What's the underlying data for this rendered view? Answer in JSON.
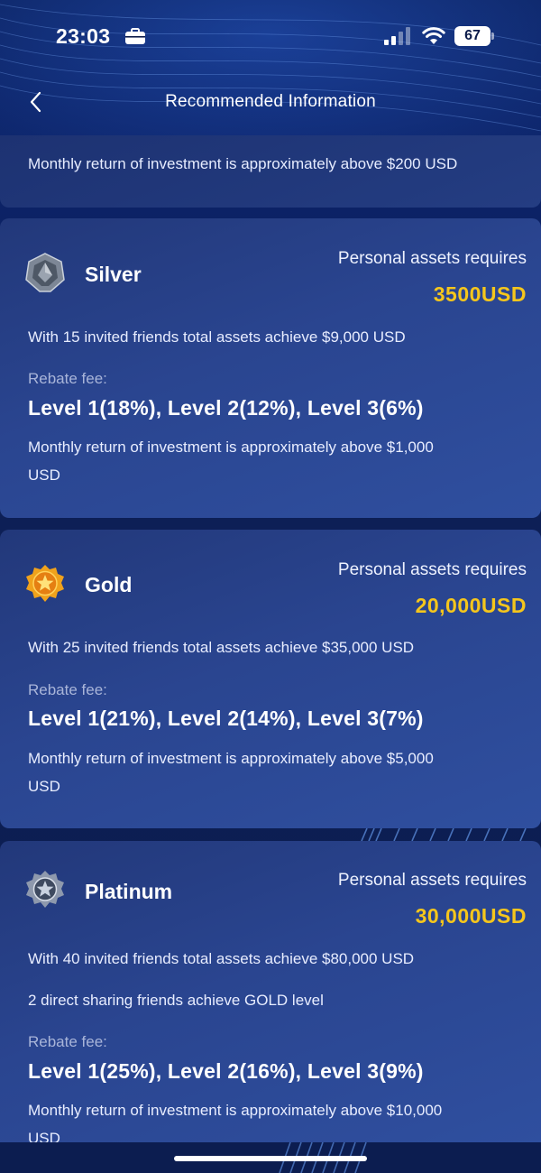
{
  "status_bar": {
    "time": "23:03",
    "battery": "67"
  },
  "nav": {
    "title": "Recommended Information"
  },
  "top_card": {
    "monthly_return": "Monthly return of investment is approximately above $200 USD"
  },
  "tiers": [
    {
      "name": "Silver",
      "icon": "silver-badge-icon",
      "requirement_label": "Personal assets requires",
      "requirement_value": "3500USD",
      "invited_friends": "With 15 invited friends total assets achieve $9,000 USD",
      "rebate_label": "Rebate fee:",
      "rebate_value": "Level 1(18%), Level 2(12%), Level 3(6%)",
      "monthly_return_1": "Monthly return of investment is approximately above $1,000",
      "monthly_return_2": "USD"
    },
    {
      "name": "Gold",
      "icon": "gold-badge-icon",
      "requirement_label": "Personal assets requires",
      "requirement_value": "20,000USD",
      "invited_friends": "With 25 invited friends total assets achieve $35,000 USD",
      "rebate_label": "Rebate fee:",
      "rebate_value": "Level 1(21%), Level 2(14%), Level 3(7%)",
      "monthly_return_1": "Monthly return of investment is approximately above $5,000",
      "monthly_return_2": "USD"
    },
    {
      "name": "Platinum",
      "icon": "platinum-badge-icon",
      "requirement_label": "Personal assets requires",
      "requirement_value": "30,000USD",
      "invited_friends": "With 40 invited friends total assets achieve $80,000 USD",
      "direct_sharing": "2 direct sharing friends achieve GOLD level",
      "rebate_label": "Rebate fee:",
      "rebate_value": "Level 1(25%), Level 2(16%), Level 3(9%)",
      "monthly_return_1": "Monthly return of investment is approximately above $10,000",
      "monthly_return_2": "USD"
    }
  ],
  "colors": {
    "accent_gold": "#f5c61c",
    "background": "#0b1b4a",
    "card": "#2a4590"
  }
}
